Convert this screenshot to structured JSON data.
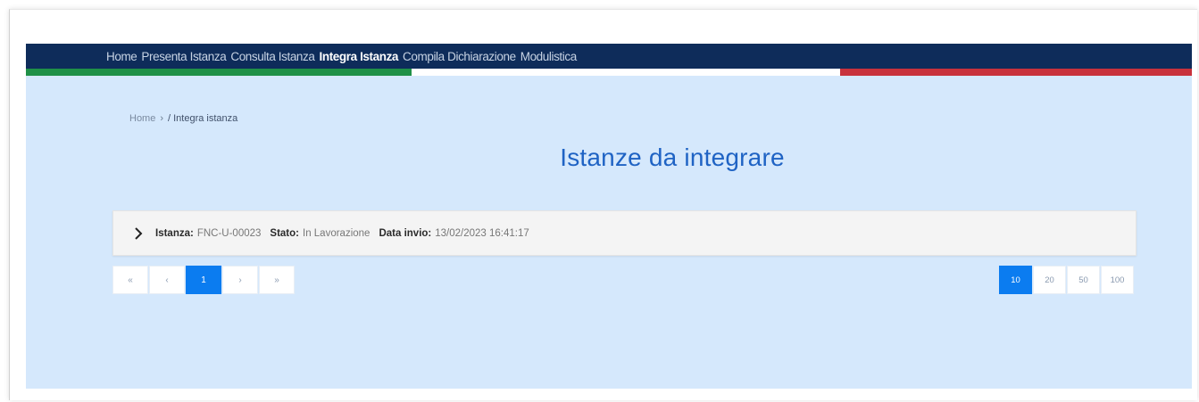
{
  "navbar": {
    "items": [
      {
        "label": "Home"
      },
      {
        "label": "Presenta Istanza"
      },
      {
        "label": "Consulta Istanza"
      },
      {
        "label": "Integra Istanza"
      },
      {
        "label": "Compila Dichiarazione"
      },
      {
        "label": "Modulistica"
      }
    ],
    "active_index": 3
  },
  "colors": {
    "navbar_bg": "#0e2c5a",
    "flag_green": "#1f9047",
    "flag_white": "#ffffff",
    "flag_red": "#c8323c",
    "page_bg": "#d5e8fc",
    "accent": "#0b7cf0",
    "title": "#1f63c4"
  },
  "breadcrumb": {
    "home": "Home",
    "separator": "›",
    "current": "/ Integra istanza"
  },
  "page_title": "Istanze da integrare",
  "instance": {
    "expand_icon": "chevron-right-icon",
    "istanza_label": "Istanza:",
    "istanza_value": "FNC-U-00023",
    "stato_label": "Stato:",
    "stato_value": "In Lavorazione",
    "data_label": "Data invio:",
    "data_value": "13/02/2023 16:41:17"
  },
  "pagination": {
    "first": "«",
    "prev": "‹",
    "current": "1",
    "next": "›",
    "last": "»"
  },
  "page_sizes": {
    "options": [
      "10",
      "20",
      "50",
      "100"
    ],
    "selected": "10"
  }
}
